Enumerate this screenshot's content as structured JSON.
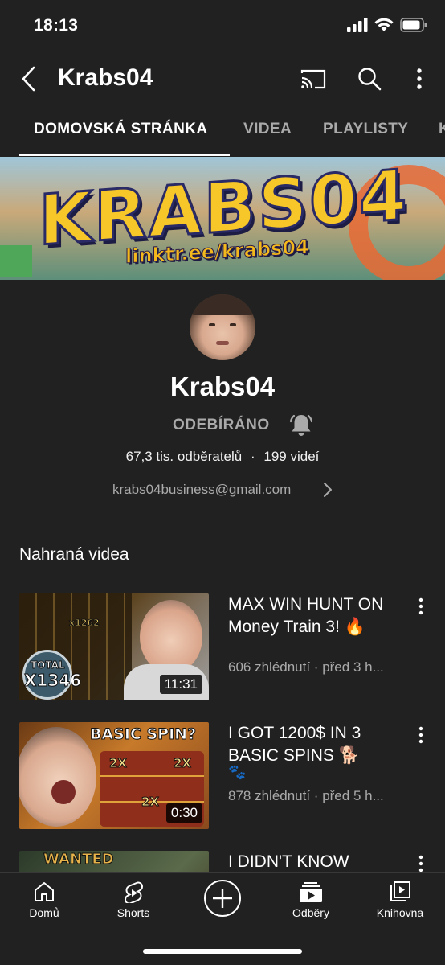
{
  "status": {
    "time": "18:13"
  },
  "header": {
    "title": "Krabs04"
  },
  "tabs": [
    {
      "label": "DOMOVSKÁ STRÁNKA",
      "active": true
    },
    {
      "label": "VIDEA",
      "active": false
    },
    {
      "label": "PLAYLISTY",
      "active": false
    },
    {
      "label": "K",
      "active": false
    }
  ],
  "banner": {
    "title": "KRABS04",
    "link": "linktr.ee/krabs04"
  },
  "channel": {
    "name": "Krabs04",
    "subscribe_label": "ODEBÍRÁNO",
    "subscribers": "67,3 tis. odběratelů",
    "separator": "·",
    "videos_count": "199 videí",
    "email": "krabs04business@gmail.com"
  },
  "uploads": {
    "title": "Nahraná videa",
    "videos": [
      {
        "title": "MAX WIN HUNT ON Money Train 3! 🔥",
        "meta": "606 zhlédnutí · před 3 h...",
        "duration": "11:31",
        "thumb_texts": [
          "TOTAL",
          "X1346",
          "x1262"
        ]
      },
      {
        "title": "I GOT 1200$ IN 3 BASIC SPINS 🐕",
        "meta_icon": "🐾",
        "meta": "878 zhlédnutí · před 5 h...",
        "duration": "0:30",
        "thumb_texts": [
          "BASIC SPIN?",
          "2X"
        ]
      },
      {
        "title": "I DIDN'T KNOW",
        "thumb_texts": [
          "WANTED"
        ]
      }
    ]
  },
  "bottom_nav": [
    {
      "label": "Domů",
      "icon": "home-icon"
    },
    {
      "label": "Shorts",
      "icon": "shorts-icon"
    },
    {
      "label": "",
      "icon": "create-icon"
    },
    {
      "label": "Odběry",
      "icon": "subscriptions-icon"
    },
    {
      "label": "Knihovna",
      "icon": "library-icon"
    }
  ],
  "colors": {
    "background": "#212121",
    "text_secondary": "#aaaaaa",
    "tab_inactive": "#aaaaaa"
  }
}
